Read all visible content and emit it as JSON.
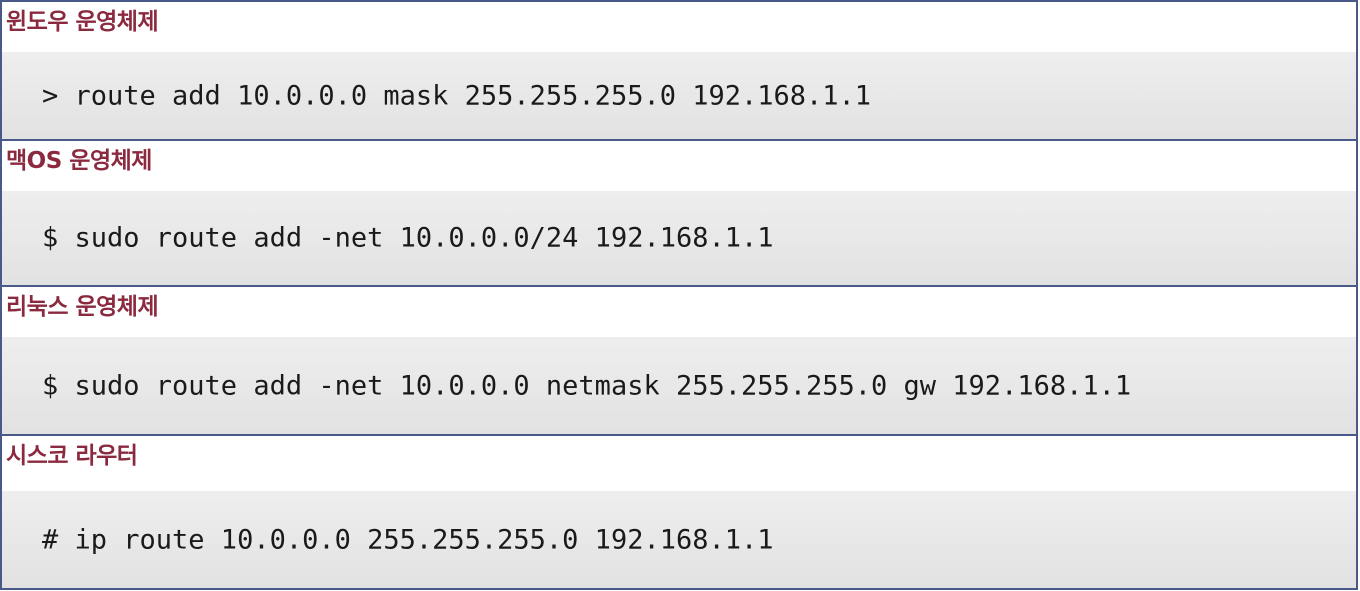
{
  "sections": [
    {
      "heading": "윈도우 운영체제",
      "command": "> route add 10.0.0.0 mask 255.255.255.0 192.168.1.1"
    },
    {
      "heading": "맥OS 운영체제",
      "command": "$ sudo route add -net 10.0.0.0/24 192.168.1.1"
    },
    {
      "heading": "리눅스 운영체제",
      "command": "$ sudo route add -net 10.0.0.0 netmask 255.255.255.0 gw 192.168.1.1"
    },
    {
      "heading": "시스코 라우터",
      "command": "# ip route 10.0.0.0 255.255.255.0 192.168.1.1"
    }
  ],
  "colors": {
    "heading": "#8b2a3e",
    "border": "#4a5a88",
    "code_background": "#e8e8e8"
  }
}
